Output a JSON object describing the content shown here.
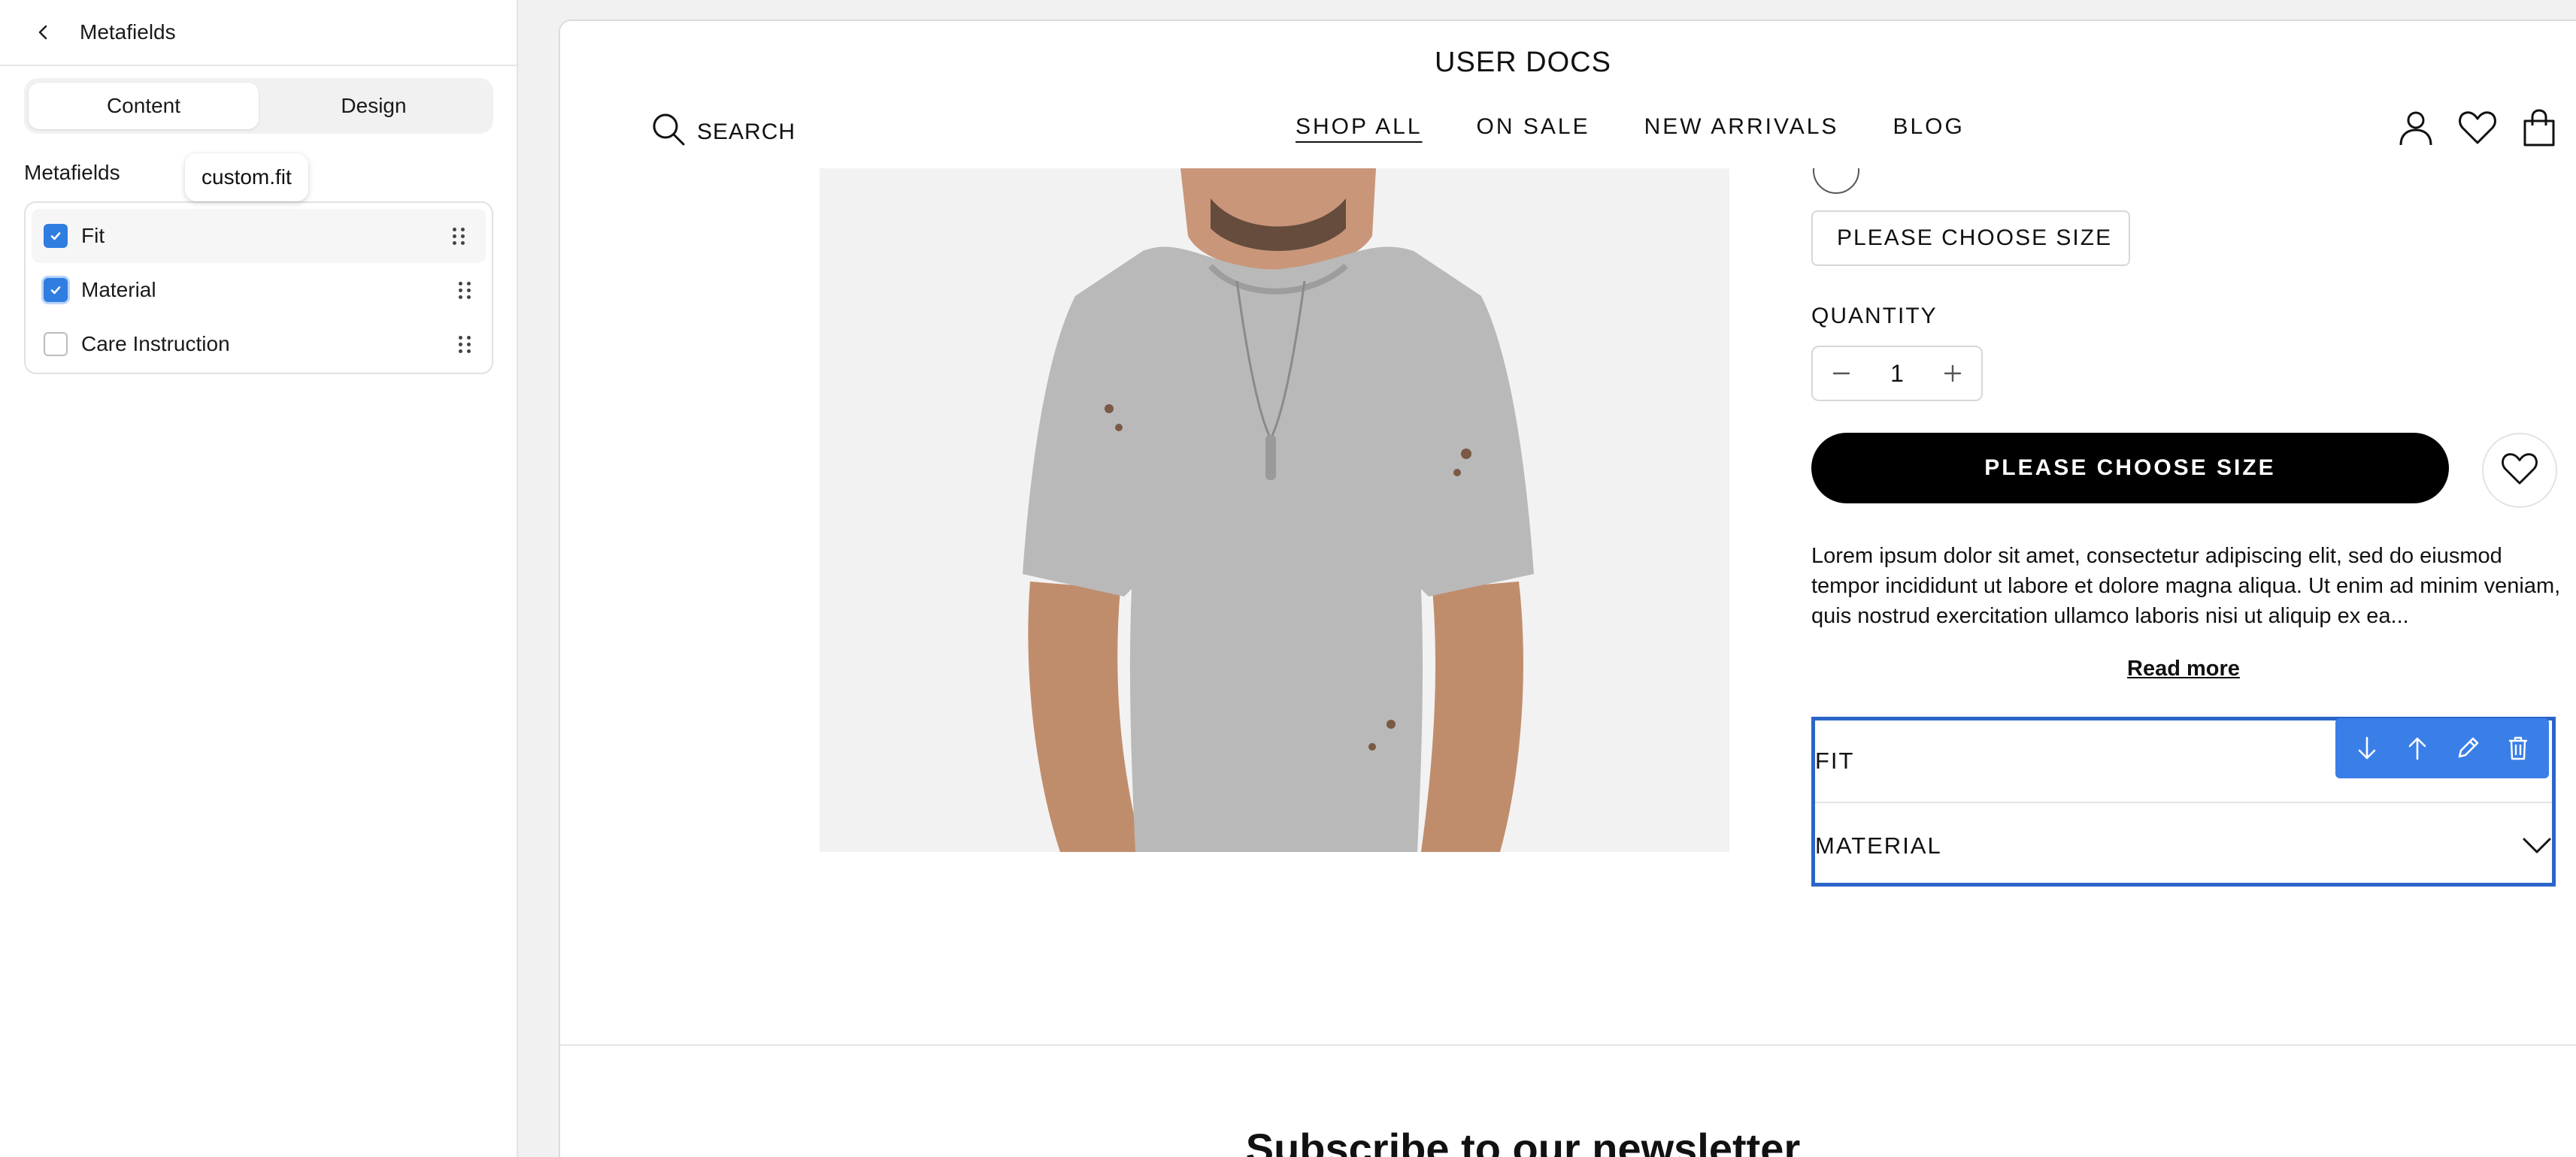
{
  "editor": {
    "title": "Metafields",
    "tabs": [
      {
        "label": "Content",
        "active": true
      },
      {
        "label": "Design",
        "active": false
      }
    ],
    "section_label": "Metafields",
    "tooltip": "custom.fit",
    "fields": [
      {
        "label": "Fit",
        "checked": true
      },
      {
        "label": "Material",
        "checked": true
      },
      {
        "label": "Care Instruction",
        "checked": false
      }
    ]
  },
  "store": {
    "title": "USER DOCS",
    "search_label": "SEARCH",
    "nav": [
      "SHOP ALL",
      "ON SALE",
      "NEW ARRIVALS",
      "BLOG"
    ],
    "header_icons": [
      "account-icon",
      "wishlist-icon",
      "cart-icon"
    ]
  },
  "product": {
    "size_button": "PLEASE CHOOSE SIZE",
    "quantity_label": "QUANTITY",
    "quantity": "1",
    "add_button": "PLEASE CHOOSE SIZE",
    "description": "Lorem ipsum dolor sit amet, consectetur adipiscing elit, sed do eiusmod tempor incididunt ut labore et dolore magna aliqua. Ut enim ad minim veniam, quis nostrud exercitation ullamco laboris nisi ut aliquip ex ea...",
    "read_more": "Read more",
    "accordion": [
      "FIT",
      "MATERIAL"
    ],
    "toolbar_icons": [
      "move-down-icon",
      "move-up-icon",
      "edit-icon",
      "delete-icon"
    ]
  },
  "newsletter": {
    "title": "Subscribe to our newsletter"
  },
  "colors": {
    "accent": "#2f7de1",
    "selection_border": "#2c64c8",
    "toolbar": "#3a7ee8",
    "button": "#000000"
  }
}
